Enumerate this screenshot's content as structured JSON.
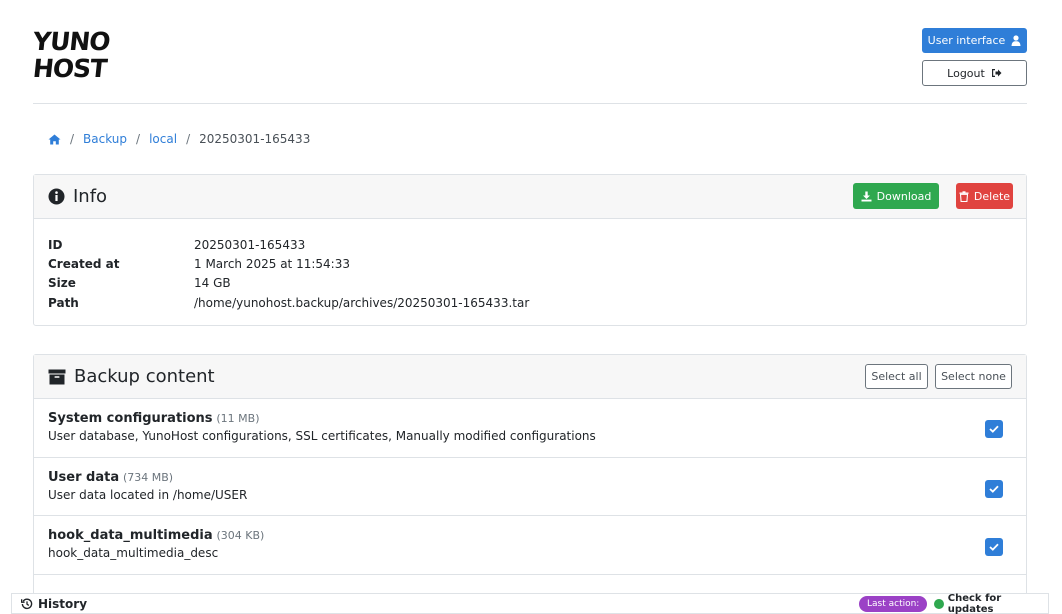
{
  "header": {
    "logo": [
      "YUNO",
      "HOST"
    ],
    "user_interface_label": "User interface",
    "logout_label": "Logout"
  },
  "breadcrumb": {
    "home_icon": "home-icon",
    "items": [
      "Backup",
      "local"
    ],
    "current": "20250301-165433"
  },
  "info": {
    "title": "Info",
    "download_label": "Download",
    "delete_label": "Delete",
    "rows": [
      {
        "key": "ID",
        "value": "20250301-165433"
      },
      {
        "key": "Created at",
        "value": "1 March 2025 at 11:54:33"
      },
      {
        "key": "Size",
        "value": "14 GB"
      },
      {
        "key": "Path",
        "value": "/home/yunohost.backup/archives/20250301-165433.tar"
      }
    ]
  },
  "backup_content": {
    "title": "Backup content",
    "select_all_label": "Select all",
    "select_none_label": "Select none",
    "items": [
      {
        "name": "System configurations",
        "size": "(11 MB)",
        "desc": "User database, YunoHost configurations, SSL certificates, Manually modified configurations",
        "checked": true
      },
      {
        "name": "User data",
        "size": "(734 MB)",
        "desc": "User data located in /home/USER",
        "checked": true
      },
      {
        "name": "hook_data_multimedia",
        "size": "(304 KB)",
        "desc": "hook_data_multimedia_desc",
        "checked": true
      }
    ]
  },
  "footer": {
    "history_label": "History",
    "last_action_label": "Last action:",
    "last_action_value": "Check for updates",
    "status_color": "#2fa84f"
  }
}
